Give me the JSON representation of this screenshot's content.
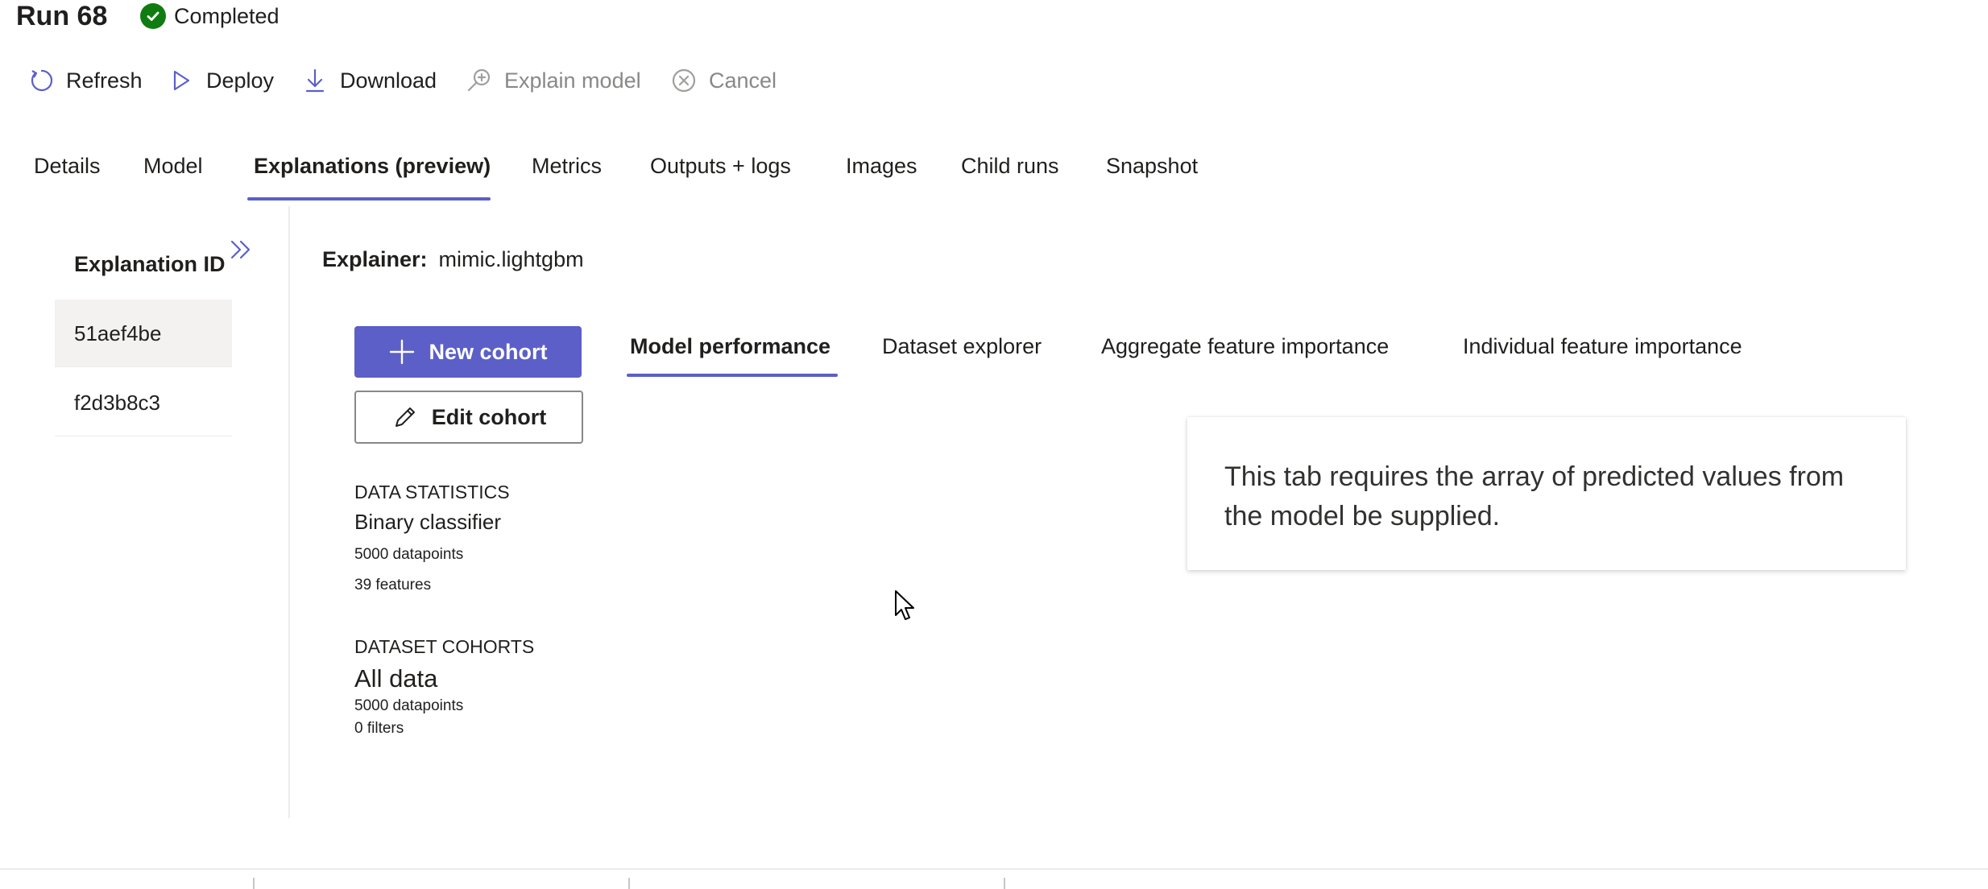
{
  "header": {
    "title": "Run 68",
    "status": "Completed",
    "status_color": "#107c10"
  },
  "toolbar": {
    "refresh": "Refresh",
    "deploy": "Deploy",
    "download": "Download",
    "explain_model": "Explain model",
    "cancel": "Cancel"
  },
  "tabs": [
    {
      "label": "Details"
    },
    {
      "label": "Model"
    },
    {
      "label": "Explanations (preview)",
      "active": true
    },
    {
      "label": "Metrics"
    },
    {
      "label": "Outputs + logs"
    },
    {
      "label": "Images"
    },
    {
      "label": "Child runs"
    },
    {
      "label": "Snapshot"
    }
  ],
  "explanations": {
    "header": "Explanation ID",
    "items": [
      {
        "id": "51aef4be",
        "selected": true
      },
      {
        "id": "f2d3b8c3"
      }
    ]
  },
  "explainer": {
    "label": "Explainer:",
    "value": "mimic.lightgbm"
  },
  "cohort": {
    "new_label": "New cohort",
    "edit_label": "Edit cohort"
  },
  "data_statistics": {
    "heading": "DATA STATISTICS",
    "type": "Binary classifier",
    "datapoints": "5000 datapoints",
    "features": "39 features"
  },
  "dataset_cohorts": {
    "heading": "DATASET COHORTS",
    "name": "All data",
    "datapoints": "5000 datapoints",
    "filters": "0 filters"
  },
  "subtabs": [
    {
      "label": "Model performance",
      "active": true
    },
    {
      "label": "Dataset explorer"
    },
    {
      "label": "Aggregate feature importance"
    },
    {
      "label": "Individual feature importance"
    }
  ],
  "message": "This tab requires the array of predicted values from the model be supplied.",
  "colors": {
    "accent": "#5b5fc7",
    "success": "#107c10"
  }
}
